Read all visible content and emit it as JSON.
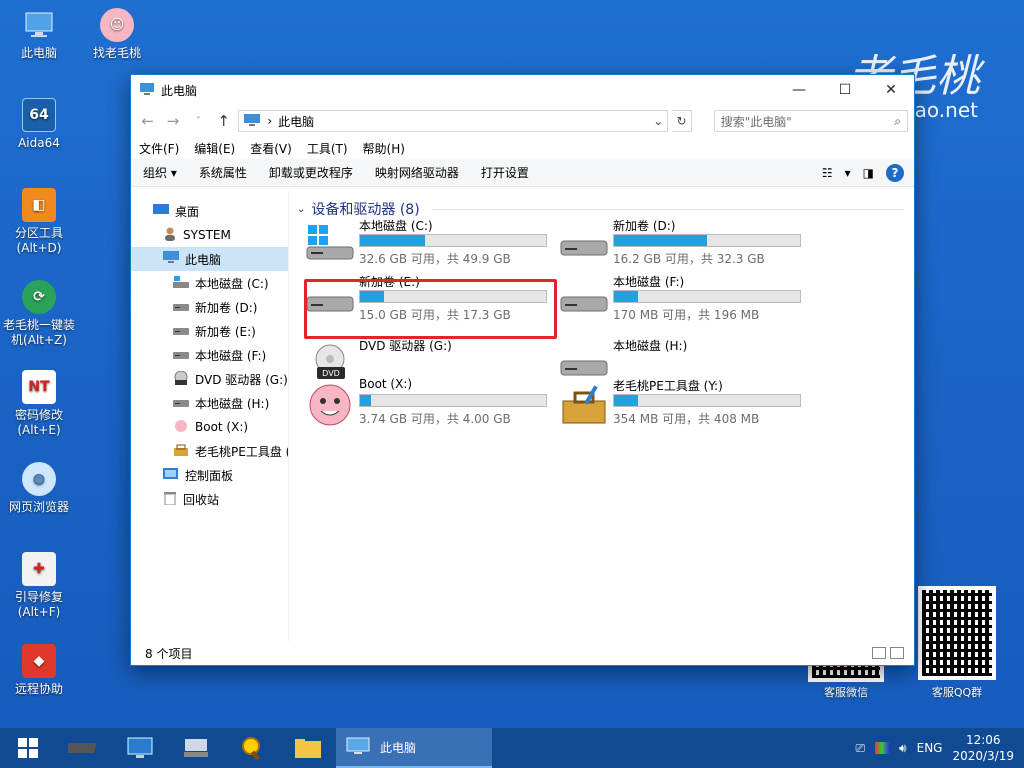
{
  "desktop": {
    "icons": [
      {
        "label": "此电脑",
        "icon": "pc-icon"
      },
      {
        "label": "找老毛桃",
        "icon": "peach-icon"
      },
      {
        "label": "Aida64",
        "icon": "aida64-icon"
      },
      {
        "label": "分区工具\n(Alt+D)",
        "icon": "partition-tool-icon"
      },
      {
        "label": "老毛桃一键装\n机(Alt+Z)",
        "icon": "installer-icon"
      },
      {
        "label": "密码修改\n(Alt+E)",
        "icon": "password-icon"
      },
      {
        "label": "网页浏览器",
        "icon": "browser-icon"
      },
      {
        "label": "引导修复\n(Alt+F)",
        "icon": "boot-repair-icon"
      },
      {
        "label": "远程协助",
        "icon": "remote-assist-icon"
      }
    ],
    "brand": "老毛桃",
    "brand_url": "tao.net",
    "qr_wechat_caption": "客服微信",
    "qr_qq_caption": "客服QQ群"
  },
  "window": {
    "title": "此电脑",
    "buttons": {
      "minimize": "—",
      "maximize": "☐",
      "close": "✕"
    },
    "address": "此电脑",
    "search_placeholder": "搜索\"此电脑\"",
    "menu": [
      "文件(F)",
      "编辑(E)",
      "查看(V)",
      "工具(T)",
      "帮助(H)"
    ],
    "commands": [
      "组织",
      "系统属性",
      "卸载或更改程序",
      "映射网络驱动器",
      "打开设置"
    ],
    "organize_arrow": "▾",
    "nav": [
      {
        "label": "桌面",
        "icon": "desktop-icon",
        "indent": 0
      },
      {
        "label": "SYSTEM",
        "icon": "user-icon",
        "indent": 1
      },
      {
        "label": "此电脑",
        "icon": "pc-icon",
        "indent": 1,
        "selected": true
      },
      {
        "label": "本地磁盘 (C:)",
        "icon": "windows-drive-icon",
        "indent": 2
      },
      {
        "label": "新加卷 (D:)",
        "icon": "drive-icon",
        "indent": 2
      },
      {
        "label": "新加卷 (E:)",
        "icon": "drive-icon",
        "indent": 2
      },
      {
        "label": "本地磁盘 (F:)",
        "icon": "drive-icon",
        "indent": 2
      },
      {
        "label": "DVD 驱动器 (G:)",
        "icon": "dvd-icon",
        "indent": 2
      },
      {
        "label": "本地磁盘 (H:)",
        "icon": "drive-icon",
        "indent": 2
      },
      {
        "label": "Boot (X:)",
        "icon": "peach-icon",
        "indent": 2
      },
      {
        "label": "老毛桃PE工具盘 (",
        "icon": "toolbox-icon",
        "indent": 2
      },
      {
        "label": "控制面板",
        "icon": "control-panel-icon",
        "indent": 1
      },
      {
        "label": "回收站",
        "icon": "recycle-bin-icon",
        "indent": 1
      }
    ],
    "group_title": "设备和驱动器 (8)",
    "drives": [
      {
        "name": "本地磁盘 (C:)",
        "free": "32.6 GB 可用，共 49.9 GB",
        "used_pct": 35,
        "icon": "windows-drive-icon",
        "bar": true
      },
      {
        "name": "新加卷 (D:)",
        "free": "16.2 GB 可用，共 32.3 GB",
        "used_pct": 50,
        "icon": "drive-icon",
        "bar": true
      },
      {
        "name": "新加卷 (E:)",
        "free": "15.0 GB 可用，共 17.3 GB",
        "used_pct": 13,
        "icon": "drive-icon",
        "bar": true,
        "highlighted": true
      },
      {
        "name": "本地磁盘 (F:)",
        "free": "170 MB 可用，共 196 MB",
        "used_pct": 13,
        "icon": "drive-icon",
        "bar": true
      },
      {
        "name": "DVD 驱动器 (G:)",
        "free": "",
        "used_pct": 0,
        "icon": "dvd-icon",
        "bar": false
      },
      {
        "name": "本地磁盘 (H:)",
        "free": "",
        "used_pct": 0,
        "icon": "drive-icon",
        "bar": false
      },
      {
        "name": "Boot (X:)",
        "free": "3.74 GB 可用，共 4.00 GB",
        "used_pct": 6,
        "icon": "peach-icon",
        "bar": true
      },
      {
        "name": "老毛桃PE工具盘 (Y:)",
        "free": "354 MB 可用，共 408 MB",
        "used_pct": 13,
        "icon": "toolbox-icon",
        "bar": true
      }
    ],
    "status_text": "8 个项目"
  },
  "taskbar": {
    "active_app": "此电脑",
    "lang": "ENG",
    "time": "12:06",
    "date": "2020/3/19"
  },
  "colors": {
    "accent": "#26a0da",
    "highlight": "#e0252b",
    "taskbar": "#0f4a93"
  }
}
